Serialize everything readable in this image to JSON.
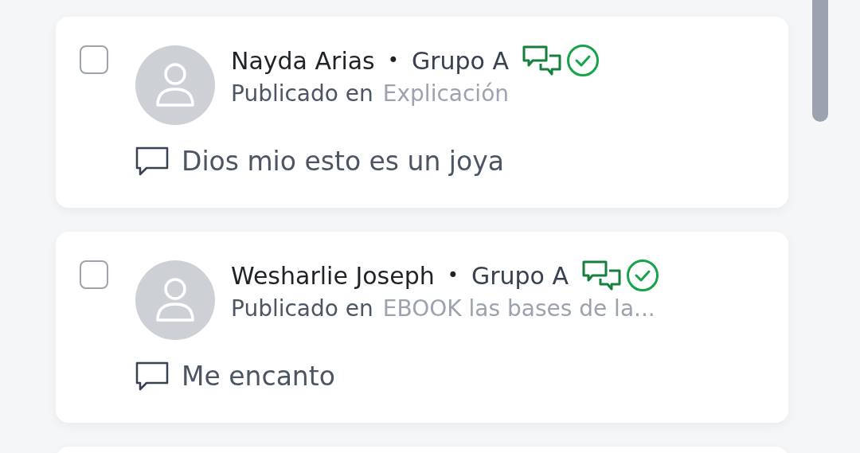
{
  "posts": [
    {
      "name": "Nayda Arias",
      "separator": "•",
      "group": "Grupo A",
      "posted_label": "Publicado en",
      "posted_in": "Explicación",
      "comment": "Dios mio esto es un joya",
      "checked": false
    },
    {
      "name": "Wesharlie Joseph",
      "separator": "•",
      "group": "Grupo A",
      "posted_label": "Publicado en",
      "posted_in": "EBOOK las bases de la...",
      "comment": "Me encanto",
      "checked": false
    }
  ]
}
